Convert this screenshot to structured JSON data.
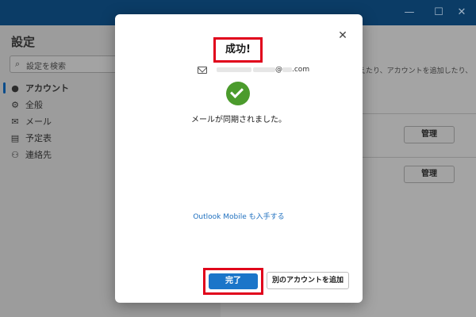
{
  "window": {
    "controls": {
      "minimize": "—",
      "maximize": "☐",
      "close": "✕"
    }
  },
  "settings": {
    "title": "設定",
    "search_placeholder": "設定を検索",
    "nav": [
      {
        "label": "アカウント",
        "icon": "person-icon",
        "active": true
      },
      {
        "label": "全般",
        "icon": "gear-icon",
        "active": false
      },
      {
        "label": "メール",
        "icon": "mail-icon",
        "active": false
      },
      {
        "label": "予定表",
        "icon": "calendar-icon",
        "active": false
      },
      {
        "label": "連絡先",
        "icon": "contacts-icon",
        "active": false
      }
    ]
  },
  "main": {
    "description": "えたり、アカウントを追加したり、",
    "manage_buttons": [
      "管理",
      "管理"
    ]
  },
  "dialog": {
    "title": "成功!",
    "email_suffix": "@",
    "email_domain": ".com",
    "message": "メールが同期されました。",
    "mobile_link": "Outlook Mobile も入手する",
    "done_label": "完了",
    "add_account_label": "別のアカウントを追加",
    "success_color": "#4b9b2c",
    "accent_color": "#1b75c9",
    "highlight_color": "#e0001b"
  }
}
